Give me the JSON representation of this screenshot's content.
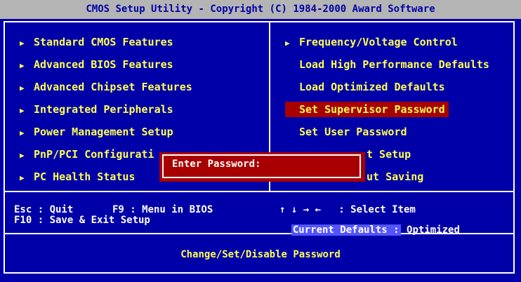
{
  "title": "CMOS Setup Utility - Copyright (C) 1984-2000 Award Software",
  "menu_left": [
    {
      "label": "Standard CMOS Features",
      "arrow": true
    },
    {
      "label": "Advanced BIOS Features",
      "arrow": true
    },
    {
      "label": "Advanced Chipset Features",
      "arrow": true
    },
    {
      "label": "Integrated Peripherals",
      "arrow": true
    },
    {
      "label": "Power Management Setup",
      "arrow": true
    },
    {
      "label": "PnP/PCI Configurati",
      "arrow": true
    },
    {
      "label": "PC Health Status",
      "arrow": true
    }
  ],
  "menu_right": [
    {
      "label": "Frequency/Voltage Control",
      "arrow": true
    },
    {
      "label": "Load High Performance Defaults",
      "arrow": false
    },
    {
      "label": "Load Optimized Defaults",
      "arrow": false
    },
    {
      "label": "Set Supervisor Password",
      "arrow": false,
      "selected": true
    },
    {
      "label": "Set User Password",
      "arrow": false
    },
    {
      "label": "t Setup",
      "arrow": false
    },
    {
      "label": "ut Saving",
      "arrow": false
    }
  ],
  "arrow_glyph": "▶",
  "help": {
    "esc": "Esc : Quit",
    "f9": "F9 : Menu in BIOS",
    "f10": "F10 : Save & Exit Setup",
    "select": "↑ ↓ → ←   : Select Item",
    "current_defaults_label": "Current Defaults :",
    "current_defaults_value": "Optimized"
  },
  "dialog": {
    "label": "Enter Password:",
    "value": ""
  },
  "status": "Change/Set/Disable Password",
  "colors": {
    "background": "#0000a8",
    "text": "#ffff54",
    "titlebar": "#b4b4b4",
    "selected": "#a80000",
    "highlight": "#5454fc"
  }
}
